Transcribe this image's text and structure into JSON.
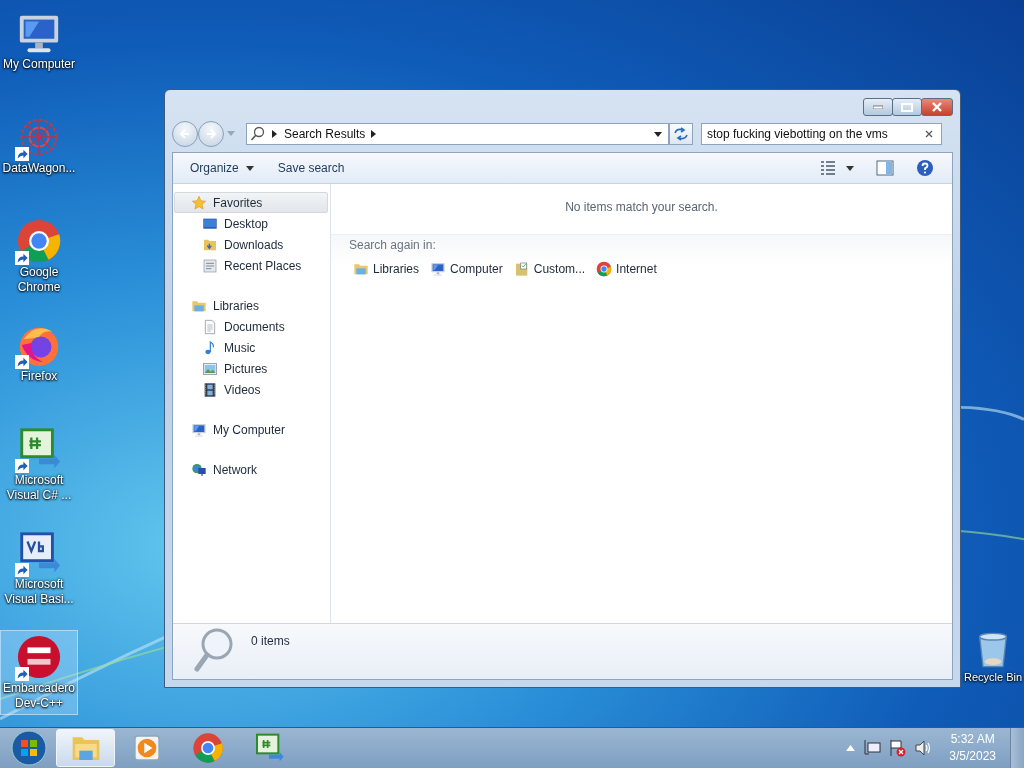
{
  "desktop_icons": [
    {
      "label": "My Computer",
      "kind": "computer",
      "shortcut": false,
      "selected": false
    },
    {
      "label": "DataWagon...",
      "kind": "datawagon",
      "shortcut": true,
      "selected": false
    },
    {
      "label": "Google Chrome",
      "kind": "chrome",
      "shortcut": true,
      "selected": false
    },
    {
      "label": "Firefox",
      "kind": "firefox",
      "shortcut": true,
      "selected": false
    },
    {
      "label": "Microsoft Visual C# ...",
      "kind": "csharp",
      "shortcut": true,
      "selected": false
    },
    {
      "label": "Microsoft Visual Basi...",
      "kind": "vb",
      "shortcut": true,
      "selected": false
    },
    {
      "label": "Embarcadero Dev-C++",
      "kind": "devcpp",
      "shortcut": true,
      "selected": true
    }
  ],
  "recycle_bin": {
    "label": "Recycle Bin"
  },
  "window": {
    "breadcrumb": [
      "Search Results"
    ],
    "search": {
      "value": "stop fucking viebotting on the vms"
    },
    "toolbar": [
      {
        "label": "Organize",
        "dropdown": true
      },
      {
        "label": "Save search",
        "dropdown": false
      }
    ],
    "nav_pane": [
      {
        "label": "Favorites",
        "kind": "star",
        "selected": true,
        "children": [
          {
            "label": "Desktop",
            "kind": "desktop",
            "selected": false
          },
          {
            "label": "Downloads",
            "kind": "downloads",
            "selected": false
          },
          {
            "label": "Recent Places",
            "kind": "recent",
            "selected": false
          }
        ]
      },
      {
        "label": "Libraries",
        "kind": "libraries",
        "selected": false,
        "children": [
          {
            "label": "Documents",
            "kind": "documents",
            "selected": false
          },
          {
            "label": "Music",
            "kind": "music",
            "selected": false
          },
          {
            "label": "Pictures",
            "kind": "pictures",
            "selected": false
          },
          {
            "label": "Videos",
            "kind": "videos",
            "selected": false
          }
        ]
      },
      {
        "label": "My Computer",
        "kind": "computer",
        "selected": false
      },
      {
        "label": "Network",
        "kind": "network",
        "selected": false
      }
    ],
    "message": "No items match your search.",
    "search_again": {
      "label": "Search again in:",
      "locations": [
        {
          "label": "Libraries",
          "kind": "libraries"
        },
        {
          "label": "Computer",
          "kind": "computer"
        },
        {
          "label": "Custom...",
          "kind": "custom"
        },
        {
          "label": "Internet",
          "kind": "chrome"
        }
      ]
    },
    "details": {
      "count": "0 items"
    }
  },
  "taskbar": {
    "buttons": [
      {
        "kind": "explorer",
        "selected": true
      },
      {
        "kind": "media",
        "selected": false
      },
      {
        "kind": "chrome",
        "selected": false
      },
      {
        "kind": "csharp",
        "selected": false
      }
    ],
    "clock": {
      "time": "5:32 AM",
      "date": "3/5/2023"
    }
  }
}
